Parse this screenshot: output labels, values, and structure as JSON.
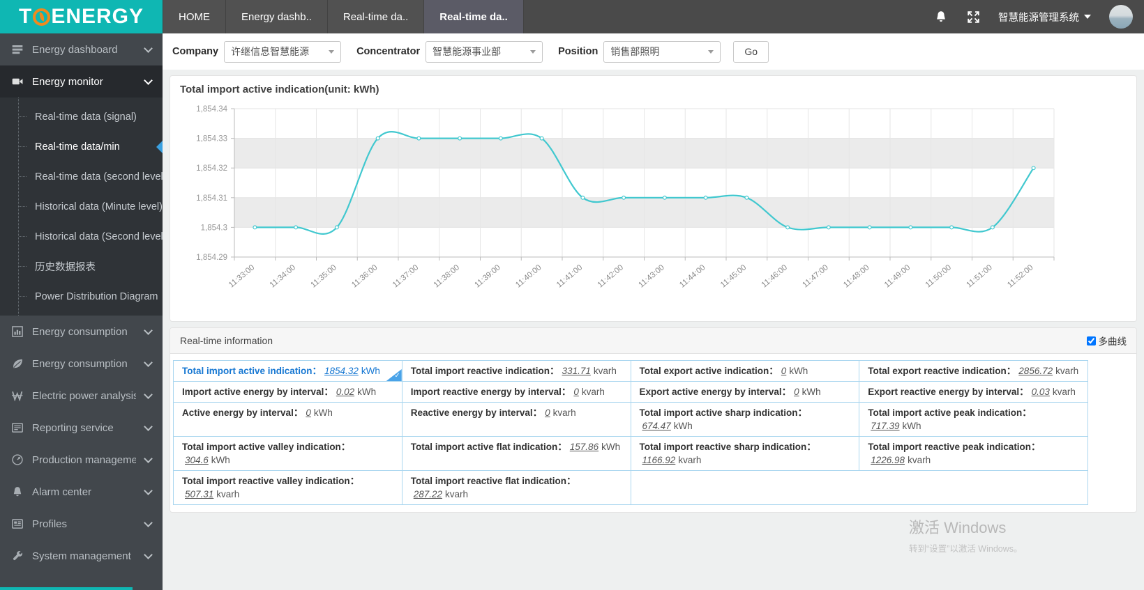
{
  "logo": {
    "prefix": "T",
    "suffix": "ENERGY"
  },
  "header": {
    "tabs": [
      {
        "label": "HOME",
        "active": false
      },
      {
        "label": "Energy dashb..",
        "active": false
      },
      {
        "label": "Real-time da..",
        "active": false
      },
      {
        "label": "Real-time da..",
        "active": true
      }
    ],
    "system_menu": "智慧能源管理系统"
  },
  "sidebar": {
    "items": [
      {
        "label": "Energy dashboard",
        "icon": "dashboard-icon"
      },
      {
        "label": "Energy monitor",
        "icon": "camera-icon",
        "active": true,
        "children": [
          {
            "label": "Real-time data (signal)",
            "selected": false
          },
          {
            "label": "Real-time data/min",
            "selected": true
          },
          {
            "label": "Real-time data (second level)",
            "selected": false
          },
          {
            "label": "Historical data (Minute level)",
            "selected": false
          },
          {
            "label": "Historical data (Second level)",
            "selected": false
          },
          {
            "label": "历史数据报表",
            "selected": false
          },
          {
            "label": "Power Distribution Diagram",
            "selected": false
          }
        ]
      },
      {
        "label": "Energy consumption",
        "icon": "bar-chart-icon"
      },
      {
        "label": "Energy consumption",
        "icon": "leaf-icon"
      },
      {
        "label": "Electric power analysis",
        "icon": "power-icon"
      },
      {
        "label": "Reporting service",
        "icon": "report-icon"
      },
      {
        "label": "Production management",
        "icon": "gauge-icon"
      },
      {
        "label": "Alarm center",
        "icon": "bell-icon"
      },
      {
        "label": "Profiles",
        "icon": "profiles-icon"
      },
      {
        "label": "System management",
        "icon": "wrench-icon"
      }
    ]
  },
  "filters": {
    "company": {
      "label": "Company",
      "value": "许继信息智慧能源"
    },
    "concentrator": {
      "label": "Concentrator",
      "value": "智慧能源事业部"
    },
    "position": {
      "label": "Position",
      "value": "销售部照明"
    },
    "go_label": "Go"
  },
  "chart_data": {
    "type": "line",
    "title": "Total import active indication(unit:  kWh)",
    "x": [
      "11:33:00",
      "11:34:00",
      "11:35:00",
      "11:36:00",
      "11:37:00",
      "11:38:00",
      "11:39:00",
      "11:40:00",
      "11:41:00",
      "11:42:00",
      "11:43:00",
      "11:44:00",
      "11:45:00",
      "11:46:00",
      "11:47:00",
      "11:48:00",
      "11:49:00",
      "11:50:00",
      "11:51:00",
      "11:52:00"
    ],
    "values": [
      1854.3,
      1854.3,
      1854.3,
      1854.33,
      1854.33,
      1854.33,
      1854.33,
      1854.33,
      1854.31,
      1854.31,
      1854.31,
      1854.31,
      1854.31,
      1854.3,
      1854.3,
      1854.3,
      1854.3,
      1854.3,
      1854.3,
      1854.32
    ],
    "ylim": [
      1854.29,
      1854.34
    ],
    "ytick_labels": [
      "1,854.34",
      "1,854.33",
      "1,854.32",
      "1,854.31",
      "1,854.3",
      "1,854.29"
    ],
    "line_color": "#41c8cf",
    "stripe_color": "#ebebeb",
    "grid": true,
    "legend_position": "none"
  },
  "realtime": {
    "title": "Real-time information",
    "multi_curve": "多曲线",
    "multi_curve_checked": true,
    "rows": [
      [
        {
          "label": "Total import active indication：",
          "value": "1854.32",
          "unit": "kWh",
          "selected": true
        },
        {
          "label": "Total import reactive indication：",
          "value": "331.71",
          "unit": "kvarh"
        },
        {
          "label": "Total export active indication：",
          "value": "0",
          "unit": "kWh"
        },
        {
          "label": "Total export reactive indication：",
          "value": "2856.72",
          "unit": "kvarh"
        }
      ],
      [
        {
          "label": "Import active energy by interval：",
          "value": "0.02",
          "unit": "kWh"
        },
        {
          "label": "Import reactive energy by interval：",
          "value": "0",
          "unit": "kvarh"
        },
        {
          "label": "Export active energy by interval：",
          "value": "0",
          "unit": "kWh"
        },
        {
          "label": "Export reactive energy by interval：",
          "value": "0.03",
          "unit": "kvarh"
        }
      ],
      [
        {
          "label": "Active energy by interval：",
          "value": "0",
          "unit": "kWh"
        },
        {
          "label": "Reactive energy by interval：",
          "value": "0",
          "unit": "kvarh"
        },
        {
          "label": "Total import active sharp indication：",
          "value": "674.47",
          "unit": "kWh"
        },
        {
          "label": "Total import active peak indication：",
          "value": "717.39",
          "unit": "kWh"
        }
      ],
      [
        {
          "label": "Total import active valley indication：",
          "value": "304.6",
          "unit": "kWh"
        },
        {
          "label": "Total import active flat indication：",
          "value": "157.86",
          "unit": "kWh"
        },
        {
          "label": "Total import reactive sharp indication：",
          "value": "1166.92",
          "unit": "kvarh"
        },
        {
          "label": "Total import reactive peak indication：",
          "value": "1226.98",
          "unit": "kvarh"
        }
      ],
      [
        {
          "label": "Total import reactive valley indication：",
          "value": "507.31",
          "unit": "kvarh"
        },
        {
          "label": "Total import reactive flat indication：",
          "value": "287.22",
          "unit": "kvarh"
        },
        {
          "empty": true,
          "span": 2
        }
      ]
    ]
  },
  "watermark": {
    "line1": "激活 Windows",
    "line2": "转到“设置”以激活 Windows。"
  }
}
